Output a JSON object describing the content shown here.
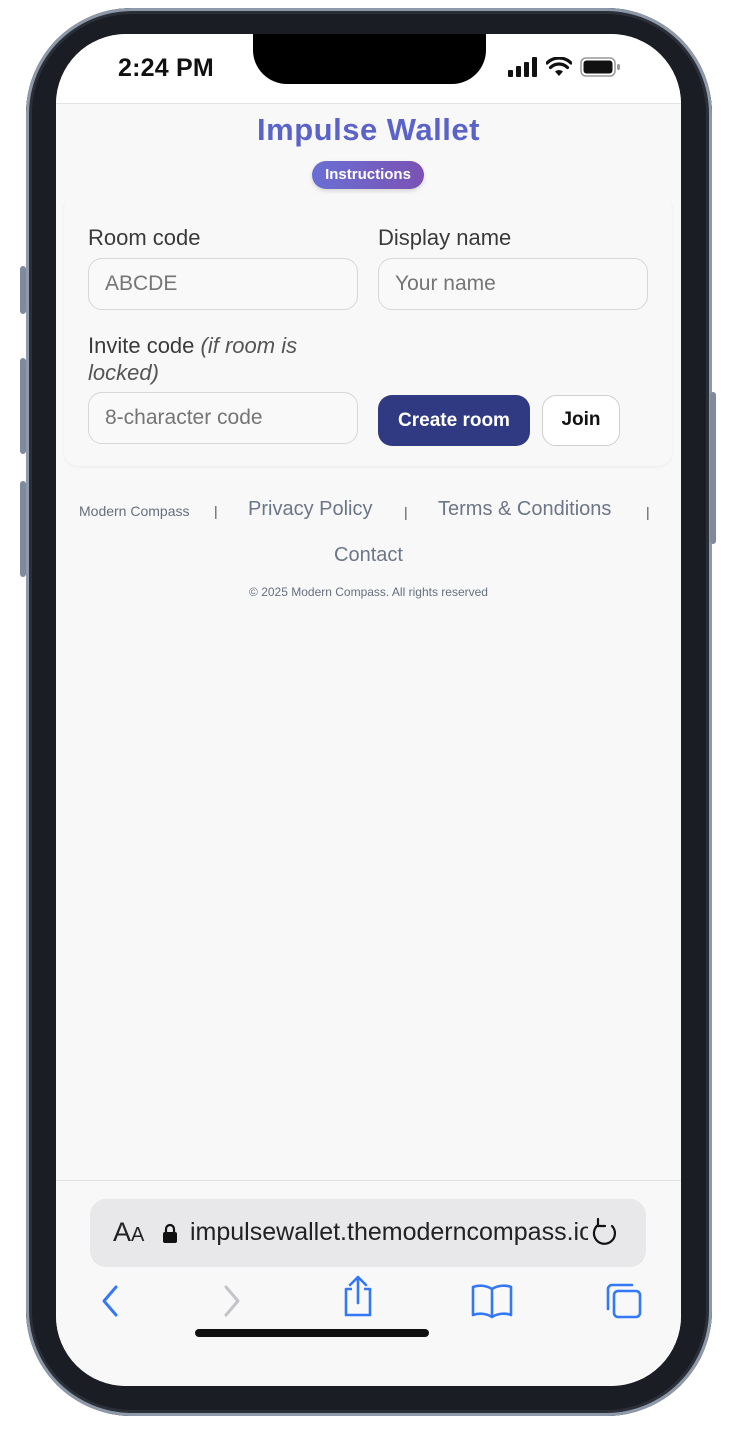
{
  "status_bar": {
    "time": "2:24 PM",
    "icons": [
      "signal-icon",
      "wifi-icon",
      "battery-icon"
    ]
  },
  "app": {
    "title": "Impulse Wallet",
    "instructions_label": "Instructions"
  },
  "form": {
    "room_code_label": "Room code",
    "room_code_placeholder": "ABCDE",
    "display_name_label": "Display name",
    "display_name_placeholder": "Your name",
    "invite_code_label": "Invite code",
    "invite_code_hint": "(if room is locked)",
    "invite_code_placeholder": "8-character code",
    "create_room_label": "Create room",
    "join_label": "Join"
  },
  "footer": {
    "company": "Modern Compass",
    "separator": "|",
    "privacy_label": "Privacy Policy",
    "terms_label": "Terms & Conditions",
    "contact_label": "Contact",
    "copyright": "© 2025 Modern Compass. All rights reserved"
  },
  "browser": {
    "text_size_label_big": "A",
    "text_size_label_small": "A",
    "url": "impulsewallet.themoderncompass.io",
    "nav_icons": [
      "back-icon",
      "forward-icon",
      "share-icon",
      "bookmarks-icon",
      "tabs-icon"
    ]
  },
  "colors": {
    "title": "#5b63c9",
    "primary_button": "#2f3a83",
    "link": "#6c7688",
    "ios_blue": "#3478f6"
  }
}
